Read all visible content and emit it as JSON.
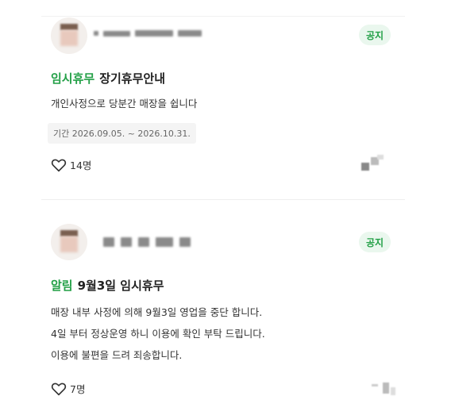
{
  "posts": [
    {
      "badge": "공지",
      "category": "임시휴무",
      "title": "장기휴무안내",
      "body_lines": [
        "개인사정으로 당분간 매장을 쉽니다"
      ],
      "period": "기간 2026.09.05. ~ 2026.10.31.",
      "likes": "14명"
    },
    {
      "badge": "공지",
      "category": "알림",
      "title": "9월3일 임시휴무",
      "body_lines": [
        "매장 내부 사정에 의해 9월3일 영업을 중단 합니다.",
        "4일 부터 정상운영 하니 이용에 확인 부탁 드립니다.",
        "이용에 불편을 드려 죄송합니다."
      ],
      "likes": "7명"
    }
  ],
  "colors": {
    "accent": "#23a047",
    "badge_bg": "#eaf7ee"
  },
  "icons": {
    "like": "heart-outline-icon"
  }
}
